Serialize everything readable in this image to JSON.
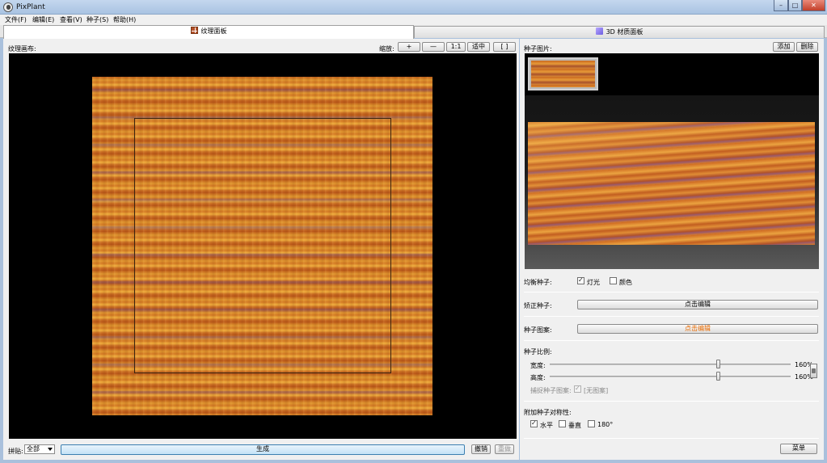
{
  "window": {
    "title": "PixPlant",
    "minimize": "–",
    "maximize": "□",
    "close": "✕"
  },
  "menubar": [
    "文件(F)",
    "编辑(E)",
    "查看(V)",
    "种子(S)",
    "帮助(H)"
  ],
  "tabs": {
    "texture": "纹理面板",
    "material": "3D 材质面板"
  },
  "left": {
    "canvas_label": "纹理画布:",
    "zoom_label": "缩放:",
    "zoom_buttons": [
      "+",
      "—",
      "1:1",
      "适中",
      "[ ]"
    ],
    "paste_label": "拼贴:",
    "paste_value": "全部",
    "generate": "生成",
    "undo": "撤销",
    "redo": "重做"
  },
  "right": {
    "seed_image_label": "种子图片:",
    "add": "添加",
    "delete": "删除",
    "balance_label": "均衡种子:",
    "balance_light": {
      "label": "灯光",
      "checked": true
    },
    "balance_color": {
      "label": "颜色",
      "checked": false
    },
    "correct_label": "矫正种子:",
    "correct_button": "点击编辑",
    "pattern_label": "种子图案:",
    "pattern_button": "点击编辑",
    "scale_label": "种子比例:",
    "width_label": "宽度:",
    "width_value": "160%",
    "width_level": 0.7,
    "height_label": "高度:",
    "height_value": "160%",
    "height_level": 0.7,
    "capture_label": "捕捉种子图案:",
    "capture_value": "[无图案]",
    "symmetry_label": "附加种子对称性:",
    "sym_horizontal": {
      "label": "水平",
      "checked": true
    },
    "sym_vertical": {
      "label": "垂直",
      "checked": false
    },
    "sym_180": {
      "label": "180°",
      "checked": false
    },
    "menu": "菜单"
  }
}
